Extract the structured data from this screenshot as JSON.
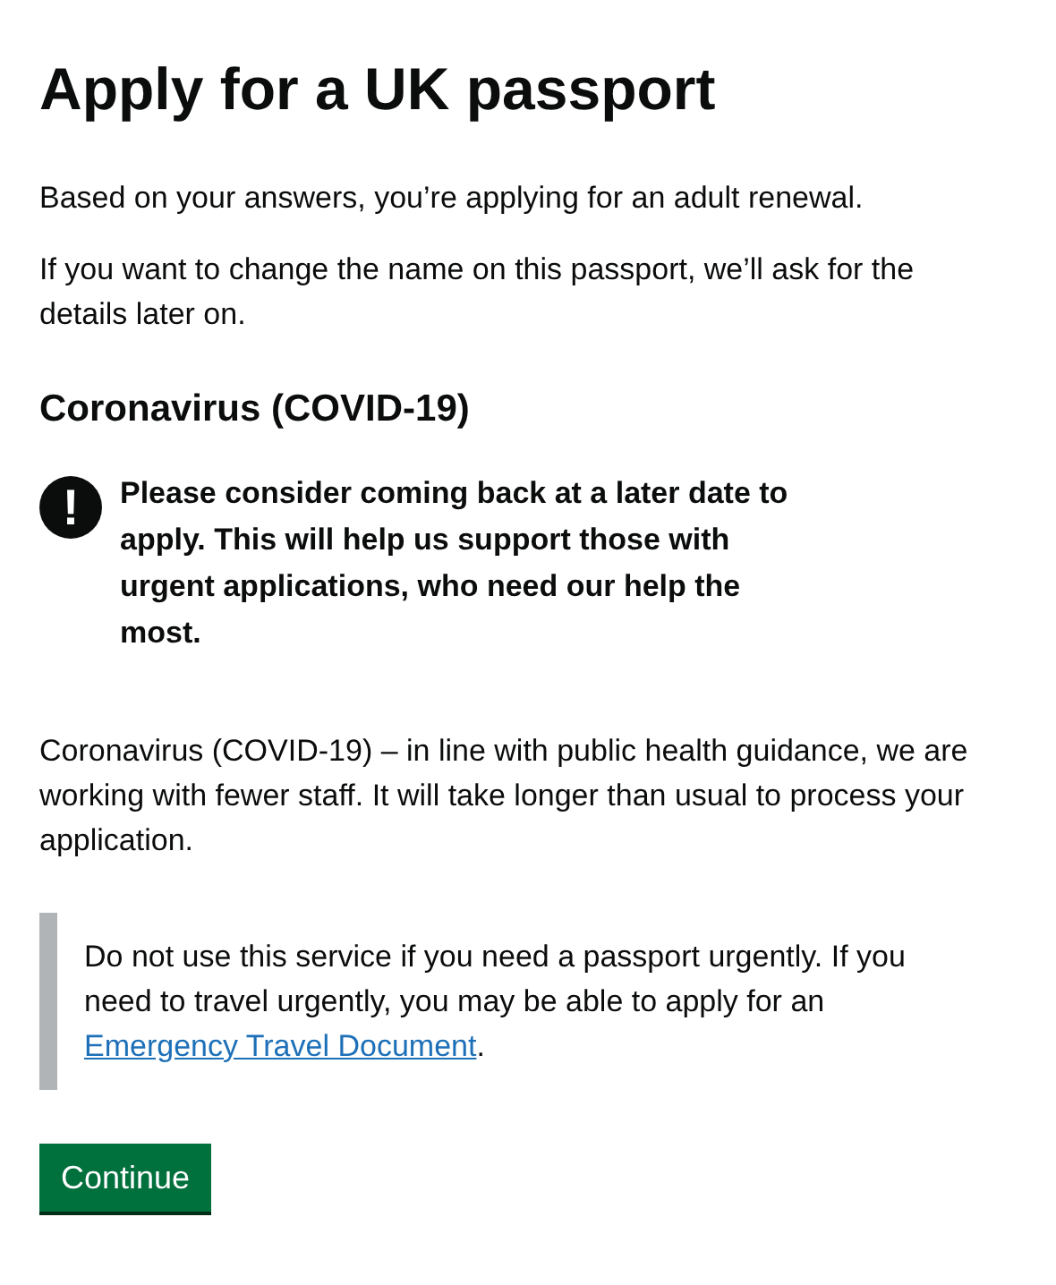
{
  "title": "Apply for a UK passport",
  "paragraphs": [
    "Based on your answers, you’re applying for an adult renewal.",
    "If you want to change the name on this passport, we’ll ask for the details later on."
  ],
  "section_heading": "Coronavirus (COVID-19)",
  "warning": {
    "icon": "!",
    "text": "Please consider coming back at a later date to apply. This will help us support those with urgent applications, who need our help the most."
  },
  "notice": "Coronavirus (COVID-19) – in line with public health guidance, we are working with fewer staff. It will take longer than usual to process your application.",
  "inset": {
    "text": "Do not use this service if you need a passport urgently. If you need to travel urgently, you may be able to apply for an",
    "link": "Emergency Travel Document",
    "after_link": "."
  },
  "button": "Continue"
}
